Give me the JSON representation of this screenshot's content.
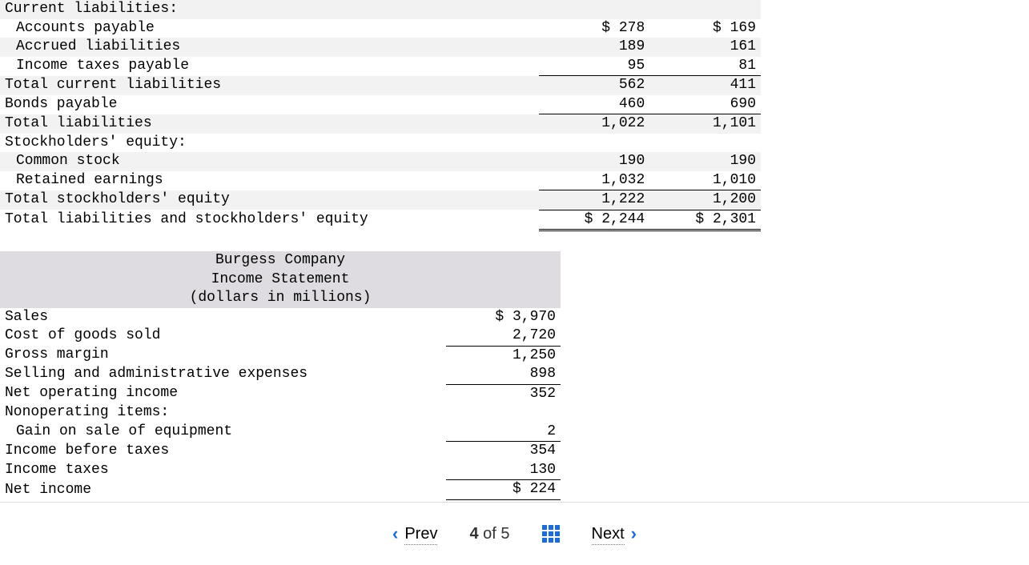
{
  "balance_sheet": {
    "section_current": "Current liabilities:",
    "acct_payable": {
      "label": "Accounts payable",
      "c1": "$ 278",
      "c2": "$ 169"
    },
    "accrued": {
      "label": "Accrued liabilities",
      "c1": "189",
      "c2": "161"
    },
    "income_tax_pay": {
      "label": "Income taxes payable",
      "c1": "95",
      "c2": "81"
    },
    "total_current": {
      "label": "Total current liabilities",
      "c1": "562",
      "c2": "411"
    },
    "bonds_payable": {
      "label": "Bonds payable",
      "c1": "460",
      "c2": "690"
    },
    "total_liab": {
      "label": "Total liabilities",
      "c1": "1,022",
      "c2": "1,101"
    },
    "section_equity": "Stockholders' equity:",
    "common_stock": {
      "label": "Common stock",
      "c1": "190",
      "c2": "190"
    },
    "retained": {
      "label": "Retained earnings",
      "c1": "1,032",
      "c2": "1,010"
    },
    "total_equity": {
      "label": "Total stockholders' equity",
      "c1": "1,222",
      "c2": "1,200"
    },
    "total_all": {
      "label": "Total liabilities and stockholders' equity",
      "c1": "$ 2,244",
      "c2": "$ 2,301"
    }
  },
  "income_statement": {
    "title1": "Burgess Company",
    "title2": "Income Statement",
    "title3": "(dollars in millions)",
    "sales": {
      "label": "Sales",
      "v": "$ 3,970"
    },
    "cogs": {
      "label": "Cost of goods sold",
      "v": "2,720"
    },
    "gross": {
      "label": "Gross margin",
      "v": "1,250"
    },
    "sga": {
      "label": "Selling and administrative expenses",
      "v": "898"
    },
    "netop": {
      "label": "Net operating income",
      "v": "352"
    },
    "nonop_hdr": "Nonoperating items:",
    "gain_eq": {
      "label": "Gain on sale of equipment",
      "v": "2"
    },
    "ebt": {
      "label": "Income before taxes",
      "v": "354"
    },
    "tax": {
      "label": "Income taxes",
      "v": "130"
    },
    "netinc": {
      "label": "Net income",
      "v": "$ 224"
    }
  },
  "nav": {
    "prev": "Prev",
    "next": "Next",
    "cur": "4",
    "of": "of",
    "tot": "5"
  }
}
